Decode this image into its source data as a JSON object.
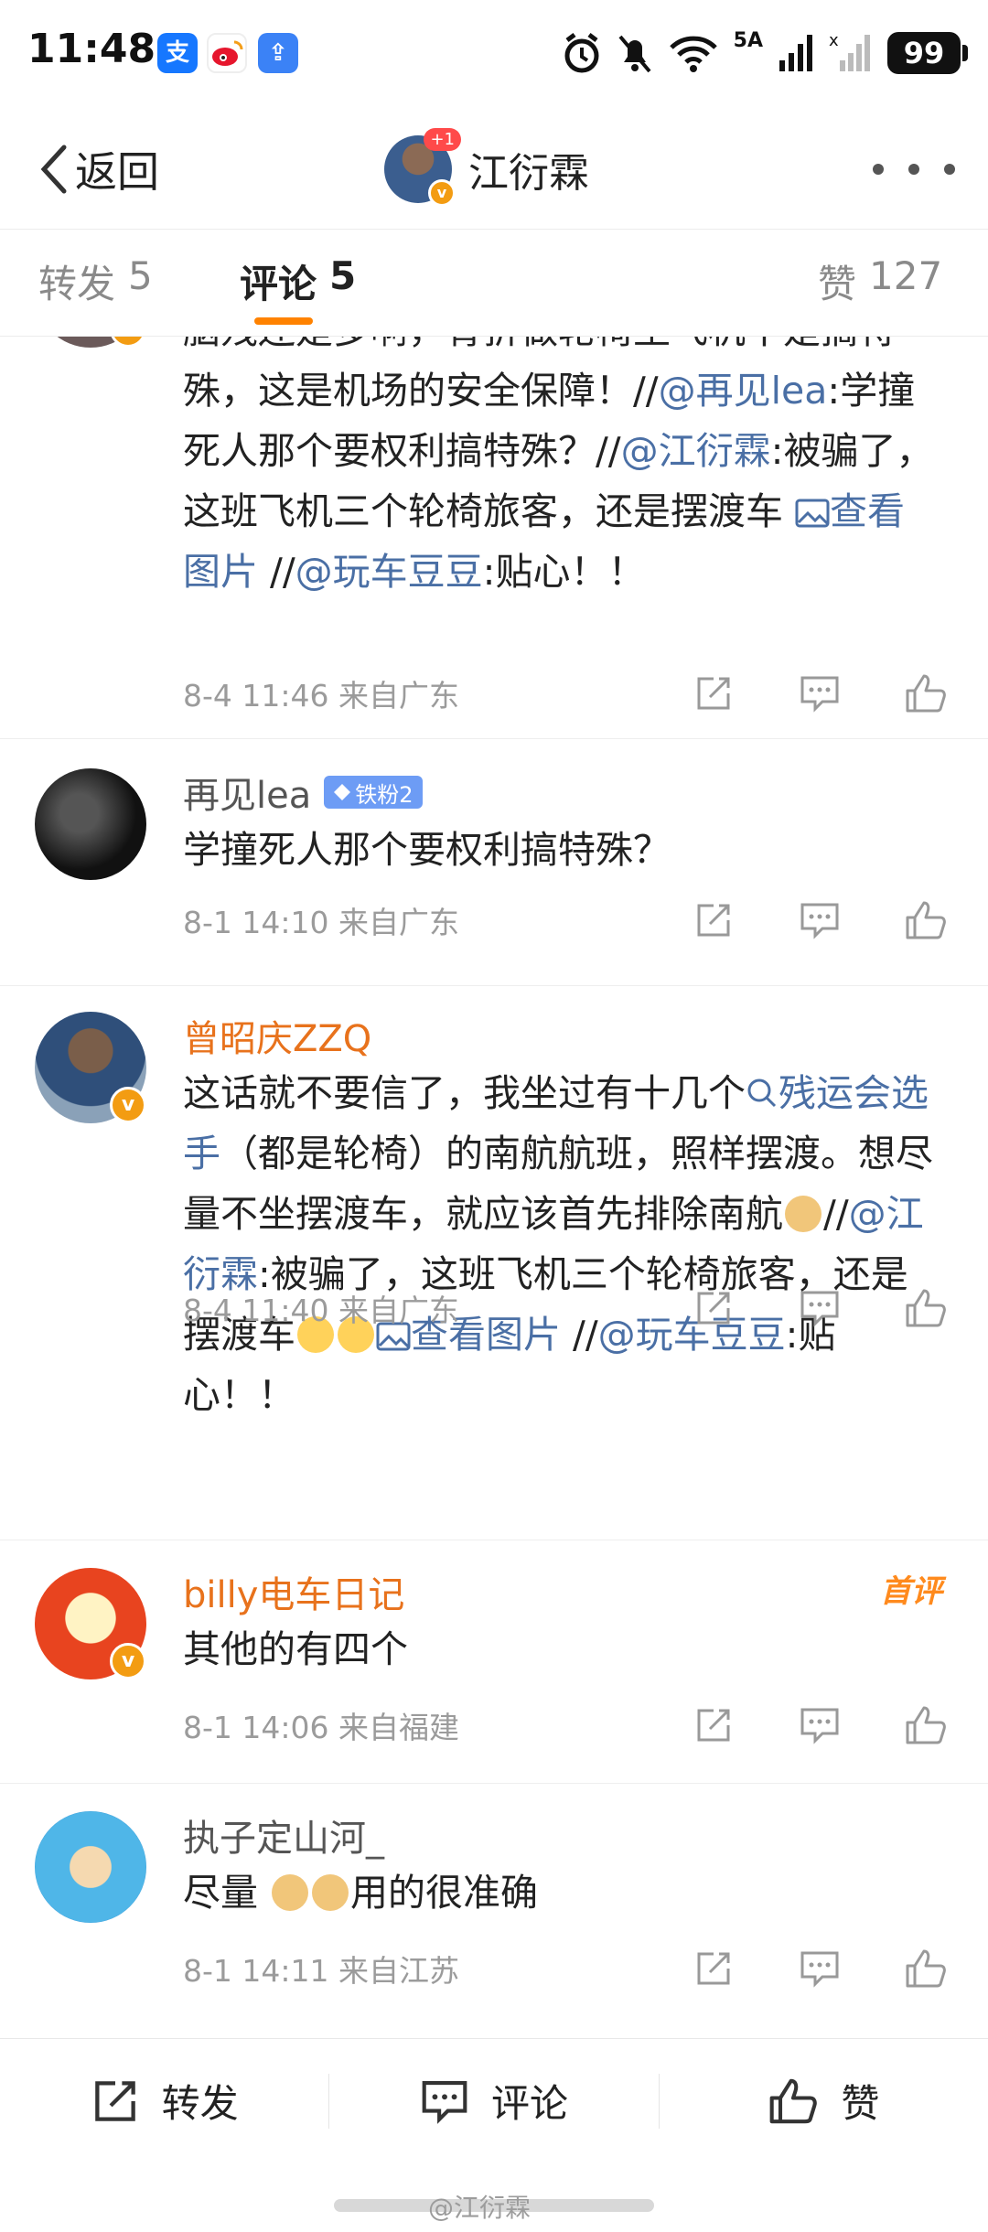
{
  "status_bar": {
    "time": "11:48",
    "apps": [
      "alipay-icon",
      "weibo-icon",
      "upload-icon"
    ],
    "network": "5A",
    "battery": "99"
  },
  "header": {
    "back_label": "返回",
    "title": "江衍霖",
    "avatar_badge": "+1"
  },
  "tabs": [
    {
      "label": "转发",
      "count": "5"
    },
    {
      "label": "评论",
      "count": "5"
    },
    {
      "label": "赞",
      "count": "127"
    }
  ],
  "comments": [
    {
      "text_parts": [
        {
          "t": "脑残还是多啊，骨折做轮椅坐飞机不是搞特殊，这是机场的安全保障！//"
        },
        {
          "t": "@再见lea",
          "link": true
        },
        {
          "t": ":学撞死人那个要权利搞特殊？//"
        },
        {
          "t": "@江衍霖",
          "link": true
        },
        {
          "t": ":被骗了，这班飞机三个轮椅旅客，还是摆渡车 "
        },
        {
          "t": "查看图片",
          "link": true
        },
        {
          "t": " //"
        },
        {
          "t": "@玩车豆豆",
          "link": true
        },
        {
          "t": ":贴心！！"
        }
      ],
      "meta": "8-4 11:46 来自广东"
    },
    {
      "username": "再见lea",
      "fan_badge": "铁粉2",
      "text_parts": [
        {
          "t": "学撞死人那个要权利搞特殊？"
        }
      ],
      "meta": "8-1 14:10 来自广东"
    },
    {
      "username": "曾昭庆ZZQ",
      "text_parts": [
        {
          "t": "这话就不要信了，我坐过有十几个"
        },
        {
          "t": "残运会选手",
          "link": true
        },
        {
          "t": "（都是轮椅）的南航航班，照样摆渡。想尽量不坐摆渡车，就应该首先排除南航"
        },
        {
          "t": "//"
        },
        {
          "t": "@江衍霖",
          "link": true
        },
        {
          "t": ":被骗了，这班飞机三个轮椅旅客，还是摆渡车"
        },
        {
          "t": "查看图片",
          "link": true
        },
        {
          "t": " //"
        },
        {
          "t": "@玩车豆豆",
          "link": true
        },
        {
          "t": ":贴心！！"
        }
      ],
      "meta": "8-4 11:40 来自广东"
    },
    {
      "username": "billy电车日记",
      "first_tag": "首评",
      "text_parts": [
        {
          "t": "其他的有四个"
        }
      ],
      "meta": "8-1 14:06 来自福建"
    },
    {
      "username": "执子定山河_",
      "text_parts": [
        {
          "t": "尽量 "
        },
        {
          "t": "用的很准确"
        }
      ],
      "meta": "8-1 14:11 来自江苏"
    }
  ],
  "bottom_bar": {
    "repost": "转发",
    "comment": "评论",
    "like": "赞"
  },
  "watermark": "@江衍霖",
  "colors": {
    "accent": "#ff8200",
    "link": "#4a6fa5",
    "username_orange": "#e8721c",
    "verified": "#f39c12"
  }
}
